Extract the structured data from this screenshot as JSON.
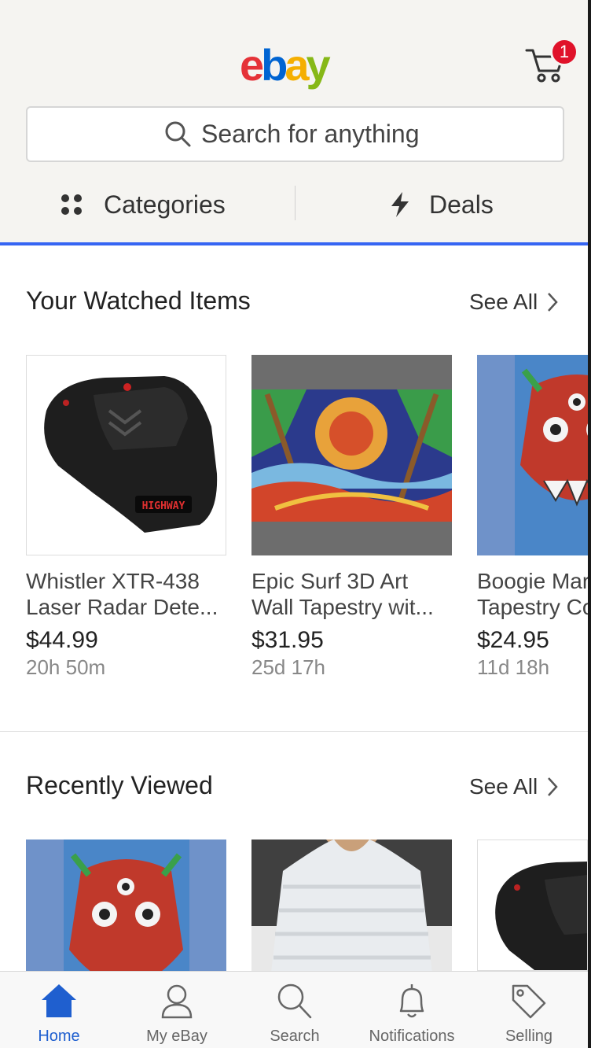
{
  "header": {
    "logo_letters": [
      "e",
      "b",
      "a",
      "y"
    ],
    "logo_colors": [
      "#e53238",
      "#0064d2",
      "#f5af02",
      "#86b817"
    ],
    "cart_badge": "1",
    "accent_color": "#3665f3"
  },
  "search": {
    "placeholder": "Search for anything"
  },
  "nav": {
    "categories_label": "Categories",
    "deals_label": "Deals"
  },
  "watched": {
    "title": "Your Watched Items",
    "see_all": "See All",
    "items": [
      {
        "title_line1": "Whistler XTR-438",
        "title_line2": "Laser Radar Dete...",
        "price": "$44.99",
        "time_left": "20h 50m",
        "image": "radar-detector-image"
      },
      {
        "title_line1": "Epic Surf 3D Art",
        "title_line2": "Wall Tapestry wit...",
        "price": "$31.95",
        "time_left": "25d 17h",
        "image": "surf-tapestry-image"
      },
      {
        "title_line1": "Boogie Mar",
        "title_line2": "Tapestry Co",
        "price": "$24.95",
        "time_left": "11d 18h",
        "image": "boogie-tapestry-image"
      }
    ]
  },
  "recent": {
    "title": "Recently Viewed",
    "see_all": "See All",
    "items": [
      {
        "image": "boogie-tapestry-image"
      },
      {
        "image": "white-shirt-image"
      },
      {
        "image": "radar-detector-image"
      }
    ]
  },
  "tabbar": {
    "tabs": [
      {
        "label": "Home",
        "icon": "home-icon",
        "active": true
      },
      {
        "label": "My eBay",
        "icon": "person-icon",
        "active": false
      },
      {
        "label": "Search",
        "icon": "search-icon",
        "active": false
      },
      {
        "label": "Notifications",
        "icon": "bell-icon",
        "active": false
      },
      {
        "label": "Selling",
        "icon": "tag-icon",
        "active": false
      }
    ],
    "active_color": "#1f5fcf"
  }
}
